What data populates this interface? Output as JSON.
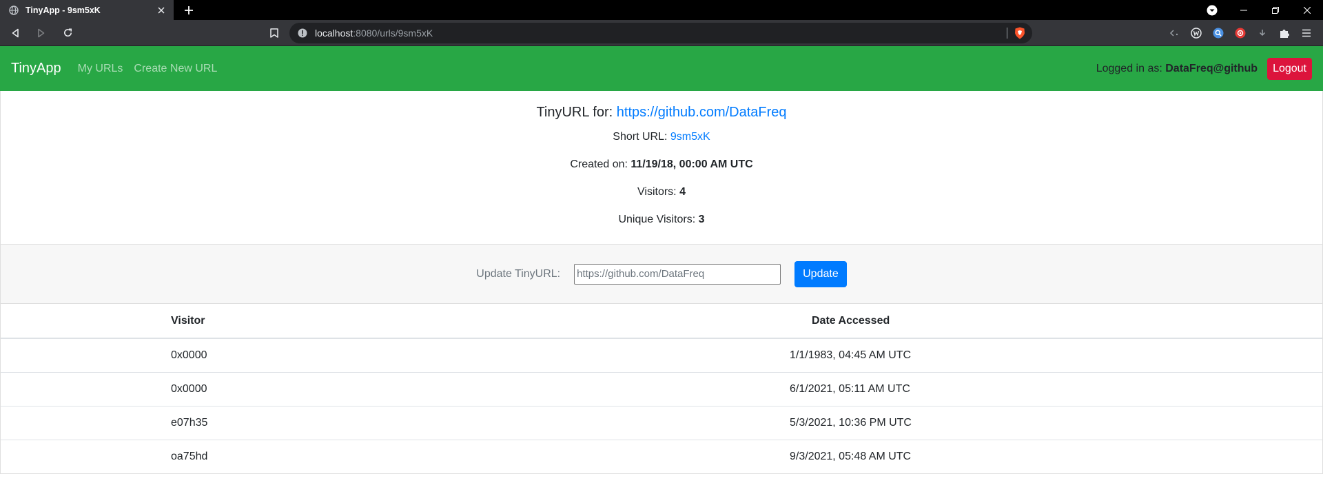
{
  "browser": {
    "tab_title": "TinyApp - 9sm5xK",
    "url_host": "localhost",
    "url_rest": ":8080/urls/9sm5xK"
  },
  "nav": {
    "brand": "TinyApp",
    "links": [
      "My URLs",
      "Create New URL"
    ],
    "logged_in_label": "Logged in as:",
    "username": "DataFreq@github",
    "logout": "Logout"
  },
  "details": {
    "title_prefix": "TinyURL for:",
    "long_url": "https://github.com/DataFreq",
    "short_label": "Short URL:",
    "short_url": "9sm5xK",
    "created_label": "Created on:",
    "created_value": "11/19/18, 00:00 AM UTC",
    "visitors_label": "Visitors:",
    "visitors_value": "4",
    "unique_label": "Unique Visitors:",
    "unique_value": "3"
  },
  "update": {
    "label": "Update TinyURL:",
    "input_value": "https://github.com/DataFreq",
    "button": "Update"
  },
  "table": {
    "headers": [
      "Visitor",
      "Date Accessed"
    ],
    "rows": [
      {
        "visitor": "0x0000",
        "date": "1/1/1983, 04:45 AM UTC"
      },
      {
        "visitor": "0x0000",
        "date": "6/1/2021, 05:11 AM UTC"
      },
      {
        "visitor": "e07h35",
        "date": "5/3/2021, 10:36 PM UTC"
      },
      {
        "visitor": "oa75hd",
        "date": "9/3/2021, 05:48 AM UTC"
      }
    ]
  },
  "colors": {
    "navbar": "#28a745",
    "link": "#007bff",
    "logout": "#dc143c",
    "update_button": "#007bff"
  }
}
